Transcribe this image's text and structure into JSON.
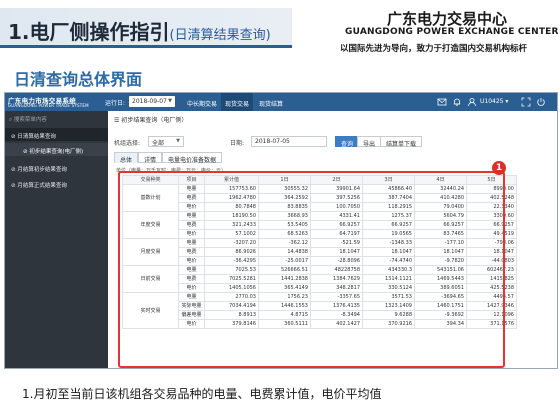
{
  "slide": {
    "title": "1.电厂侧操作指引",
    "subtitle": "(日清算结果查询)",
    "org_name_cn": "广东电力交易中心",
    "org_name_en": "GUANGDONG POWER EXCHANGE CENTER",
    "slogan": "以国际先进为导向，致力于打造国内交易机构标杆",
    "section_title": "日清查询总体界面",
    "caption": "1.月初至当前日该机组各交易品种的电量、电费累计值，电价平均值",
    "badge_number": "1",
    "colors": {
      "accent": "#2c5d93",
      "highlight": "#e8332a",
      "section": "#2d6aa8"
    }
  },
  "app": {
    "logo_cn": "广东电力市场交易系统",
    "logo_en": "GUANGDONG POWER TRADE SYSTEM",
    "run_date_label": "运行日:",
    "run_date_value": "2018-09-07",
    "nav": [
      "中长期交易",
      "现货交易",
      "现货结算"
    ],
    "user": "U10425",
    "sidebar": {
      "search_placeholder": "搜索菜单内容",
      "items": [
        {
          "label": "日清算结果查询",
          "icon": "link-icon"
        },
        {
          "label": "初步结果查询(电厂侧)",
          "icon": "link-icon"
        },
        {
          "label": "月结算初步结果查询",
          "icon": "link-icon"
        },
        {
          "label": "月结算正式结果查询",
          "icon": "link-icon"
        }
      ]
    },
    "panel_title": "初步结果查询（电厂侧）",
    "filters": {
      "unit_label": "机组选择:",
      "unit_value": "全部",
      "date_label": "日期:",
      "date_value": "2018-07-05"
    },
    "buttons": {
      "query": "查询",
      "export": "导出",
      "settle_sheet": "结算单下载"
    },
    "tabs": [
      "总体",
      "详情",
      "电量电价准备数据"
    ],
    "unit_note": "单位（电量：万千瓦时；电费：万元；电价：元）",
    "table": {
      "headers": [
        "交易种类",
        "项目",
        "累计值",
        "1日",
        "2日",
        "3日",
        "4日",
        "5日"
      ],
      "groups": [
        {
          "name": "基数计划",
          "rows": [
            {
              "item": "电量",
              "values": [
                "157753.60",
                "30555.32",
                "39901.64",
                "45866.40",
                "32440.24",
                "8990.00"
              ]
            },
            {
              "item": "电费",
              "values": [
                "1962.4780",
                "364.2592",
                "397.5256",
                "387.7404",
                "410.4280",
                "402.5248"
              ]
            },
            {
              "item": "电价",
              "values": [
                "80.7848",
                "83.8835",
                "100.7050",
                "118.2915",
                "79.0400",
                "22.3340"
              ]
            }
          ]
        },
        {
          "name": "年度交易",
          "rows": [
            {
              "item": "电量",
              "values": [
                "18190.50",
                "3668.93",
                "4331.41",
                "1275.37",
                "5604.79",
                "3309.60"
              ]
            },
            {
              "item": "电费",
              "values": [
                "321.2433",
                "53.5405",
                "66.9257",
                "66.9257",
                "66.9257",
                "66.9257"
              ]
            },
            {
              "item": "电价",
              "values": [
                "57.1002",
                "68.5263",
                "64.7197",
                "19.0565",
                "83.7465",
                "49.4519"
              ]
            }
          ]
        },
        {
          "name": "月度交易",
          "rows": [
            {
              "item": "电量",
              "values": [
                "-3207.20",
                "-362.12",
                "-521.59",
                "-1348.33",
                "-177.10",
                "-798.06"
              ]
            },
            {
              "item": "电费",
              "values": [
                "86.9026",
                "14.4838",
                "18.1047",
                "18.1047",
                "18.1047",
                "18.1047"
              ]
            },
            {
              "item": "电价",
              "values": [
                "-36.4295",
                "-25.0017",
                "-28.8096",
                "-74.4740",
                "-9.7820",
                "-44.0803"
              ]
            }
          ]
        },
        {
          "name": "日前交易",
          "rows": [
            {
              "item": "电量",
              "values": [
                "7025.53",
                "526666.51",
                "48228758",
                "434330.3",
                "543151.06",
                "602467.23"
              ]
            },
            {
              "item": "电费",
              "values": [
                "7025.5281",
                "1441.2838",
                "1384.7629",
                "1314.1121",
                "1469.5443",
                "1415.825"
              ]
            },
            {
              "item": "电价",
              "values": [
                "1405.1056",
                "365.4149",
                "348.2817",
                "330.5124",
                "389.6051",
                "425.5238"
              ]
            }
          ]
        },
        {
          "name": "实时交易",
          "rows": [
            {
              "item": "电量",
              "values": [
                "2770.03",
                "1756.23",
                "-3357.65",
                "3571.53",
                "-3694.65",
                "4494.57"
              ]
            },
            {
              "item": "实际电量",
              "values": [
                "7034.4194",
                "1446.1553",
                "1376.4135",
                "1323.1409",
                "1460.1751",
                "1427.9346"
              ]
            },
            {
              "item": "偏差电量",
              "values": [
                "8.8913",
                "4.8715",
                "-8.3494",
                "9.6288",
                "-9.3692",
                "12.1096"
              ]
            },
            {
              "item": "电价",
              "values": [
                "379.8146",
                "360.5111",
                "402.1427",
                "370.9216",
                "394.34",
                "371.1576"
              ]
            }
          ]
        }
      ]
    }
  }
}
